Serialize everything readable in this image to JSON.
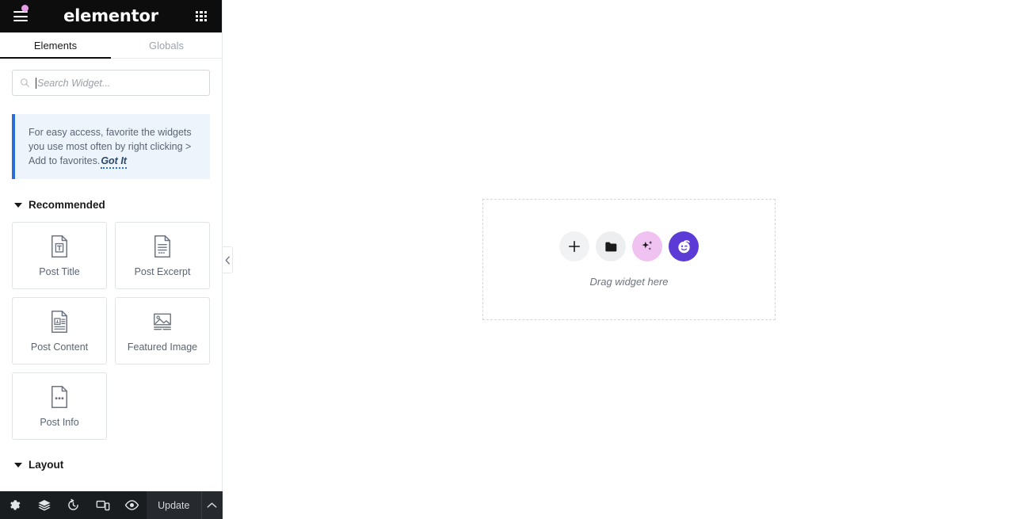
{
  "app": {
    "brand": "elementor"
  },
  "header": {
    "menu_icon": "hamburger-menu-icon",
    "notification_dot": true,
    "apps_icon": "apps-grid-icon"
  },
  "tabs": [
    {
      "label": "Elements",
      "active": true
    },
    {
      "label": "Globals",
      "active": false
    }
  ],
  "search": {
    "placeholder": "Search Widget...",
    "value": "",
    "icon": "search-icon"
  },
  "notice": {
    "text": "For easy access, favorite the widgets you use most often by right clicking > Add to favorites.",
    "action_label": "Got It",
    "accent_color": "#2b6ed9",
    "background_color": "#eef4fb"
  },
  "categories": [
    {
      "title": "Recommended",
      "expanded": true,
      "widgets": [
        {
          "label": "Post Title",
          "icon": "post-title-icon"
        },
        {
          "label": "Post Excerpt",
          "icon": "post-excerpt-icon"
        },
        {
          "label": "Post Content",
          "icon": "post-content-icon"
        },
        {
          "label": "Featured Image",
          "icon": "featured-image-icon"
        },
        {
          "label": "Post Info",
          "icon": "post-info-icon"
        }
      ]
    },
    {
      "title": "Layout",
      "expanded": true,
      "widgets": []
    }
  ],
  "collapse_handle": {
    "icon": "chevron-left-icon"
  },
  "footer": {
    "buttons": [
      {
        "name": "settings",
        "icon": "gear-icon"
      },
      {
        "name": "navigator",
        "icon": "layers-icon"
      },
      {
        "name": "history",
        "icon": "history-clock-icon"
      },
      {
        "name": "responsive",
        "icon": "responsive-devices-icon"
      },
      {
        "name": "preview",
        "icon": "eye-icon"
      }
    ],
    "update_label": "Update",
    "update_caret_icon": "chevron-up-icon"
  },
  "canvas": {
    "dropzone": {
      "label": "Drag widget here",
      "buttons": [
        {
          "name": "add-element",
          "icon": "plus-icon",
          "color": "#f1f2f3"
        },
        {
          "name": "add-template",
          "icon": "folder-icon",
          "color": "#eceef0"
        },
        {
          "name": "ai-builder",
          "icon": "sparkles-icon",
          "color": "#f0c2f2"
        },
        {
          "name": "assistant",
          "icon": "winking-face-icon",
          "color": "#5b3ad6"
        }
      ]
    }
  }
}
